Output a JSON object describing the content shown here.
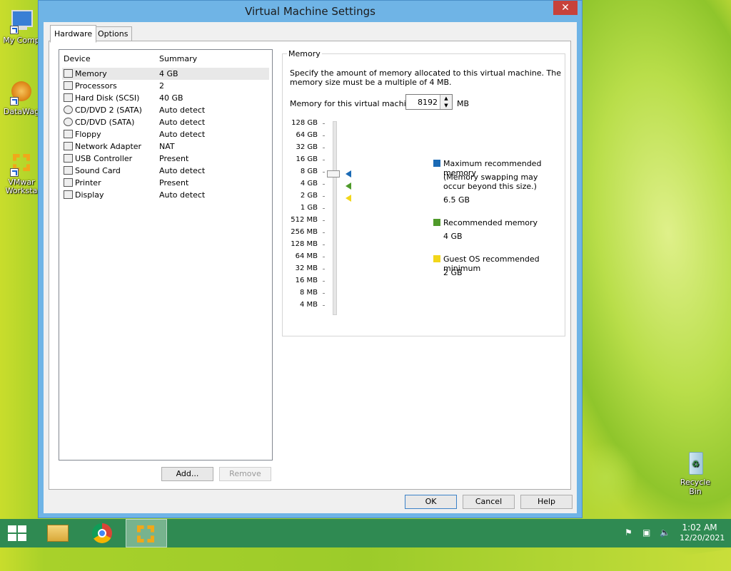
{
  "desktop": {
    "icons": [
      {
        "label": "My Comp"
      },
      {
        "label": "DataWag"
      },
      {
        "label": "VMwar\nWorksta"
      },
      {
        "label": "Recycle Bin"
      }
    ]
  },
  "window": {
    "title": "Virtual Machine Settings",
    "close_glyph": "✕",
    "tabs": [
      {
        "label": "Hardware"
      },
      {
        "label": "Options"
      }
    ],
    "device_list": {
      "header_device": "Device",
      "header_summary": "Summary",
      "rows": [
        {
          "device": "Memory",
          "summary": "4 GB"
        },
        {
          "device": "Processors",
          "summary": "2"
        },
        {
          "device": "Hard Disk (SCSI)",
          "summary": "40 GB"
        },
        {
          "device": "CD/DVD 2 (SATA)",
          "summary": "Auto detect"
        },
        {
          "device": "CD/DVD (SATA)",
          "summary": "Auto detect"
        },
        {
          "device": "Floppy",
          "summary": "Auto detect"
        },
        {
          "device": "Network Adapter",
          "summary": "NAT"
        },
        {
          "device": "USB Controller",
          "summary": "Present"
        },
        {
          "device": "Sound Card",
          "summary": "Auto detect"
        },
        {
          "device": "Printer",
          "summary": "Present"
        },
        {
          "device": "Display",
          "summary": "Auto detect"
        }
      ]
    },
    "add_label": "Add...",
    "remove_label": "Remove",
    "memory": {
      "group_title": "Memory",
      "description": "Specify the amount of memory allocated to this virtual machine. The memory size must be a multiple of 4 MB.",
      "field_label": "Memory for this virtual machine:",
      "value": "8192",
      "unit": "MB",
      "scale": [
        "128 GB",
        "64 GB",
        "32 GB",
        "16 GB",
        "8 GB",
        "4 GB",
        "2 GB",
        "1 GB",
        "512 MB",
        "256 MB",
        "128 MB",
        "64 MB",
        "32 MB",
        "16 MB",
        "8 MB",
        "4 MB"
      ],
      "legend": {
        "max_title": "Maximum recommended memory",
        "max_note": "(Memory swapping may occur beyond this size.)",
        "max_value": "6.5 GB",
        "rec_title": "Recommended memory",
        "rec_value": "4 GB",
        "min_title": "Guest OS recommended minimum",
        "min_value": "2 GB"
      },
      "colors": {
        "max": "#1b6ab5",
        "rec": "#4f9a2a",
        "min": "#f2d61a"
      }
    },
    "ok_label": "OK",
    "cancel_label": "Cancel",
    "help_label": "Help"
  },
  "taskbar": {
    "time": "1:02 AM",
    "date": "12/20/2021"
  }
}
